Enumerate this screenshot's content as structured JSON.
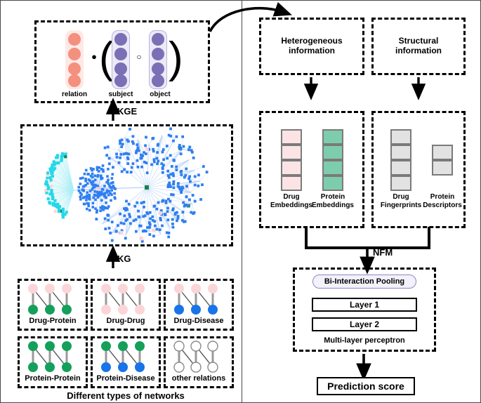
{
  "figure": {
    "panels": {
      "left_caption": "Different types of networks",
      "divider_color": "#4a4a4a"
    },
    "kge_block": {
      "operator_dot": "●",
      "operator_circle": "○",
      "paren_open": "(",
      "paren_close": ")",
      "vectors": [
        {
          "name": "relation",
          "label": "relation",
          "cells": 4,
          "dot_color": "#f4907e",
          "box_color": "#fde9e6"
        },
        {
          "name": "subject",
          "label": "subject",
          "cells": 4,
          "dot_color": "#7b6fb5",
          "box_color": "#eceaf6"
        },
        {
          "name": "object",
          "label": "object",
          "cells": 4,
          "dot_color": "#7b6fb5",
          "box_color": "#eceaf6"
        }
      ],
      "arrow_label": "KGE"
    },
    "kg_block": {
      "arrow_label": "KG",
      "graph": {
        "type": "network-graph",
        "main_cluster_color": "#2f7ef0",
        "secondary_cluster_color": "#25d8e8",
        "highlight_drug_color": "#fbd5d8",
        "highlight_protein_color": "#12844a",
        "edge_color": "#9ec4f5"
      }
    },
    "networks": [
      {
        "name": "drug-protein",
        "label": "Drug-Protein",
        "top_color": "#fbd5d8",
        "bottom_color": "#14a05a"
      },
      {
        "name": "drug-drug",
        "label": "Drug-Drug",
        "top_color": "#fbd5d8",
        "bottom_color": "#fbd5d8"
      },
      {
        "name": "drug-disease",
        "label": "Drug-Disease",
        "top_color": "#fbd5d8",
        "bottom_color": "#1874e8"
      },
      {
        "name": "protein-protein",
        "label": "Protein-Protein",
        "top_color": "#14a05a",
        "bottom_color": "#14a05a"
      },
      {
        "name": "protein-disease",
        "label": "Protein-Disease",
        "top_color": "#14a05a",
        "bottom_color": "#1874e8"
      },
      {
        "name": "other-relations",
        "label": "other relations",
        "top_color": "#ffffff",
        "bottom_color": "#ffffff"
      }
    ],
    "info_sources": [
      {
        "name": "heterogeneous",
        "label": "Heterogeneous\ninformation",
        "line1": "Heterogeneous",
        "line2": "information"
      },
      {
        "name": "structural",
        "label": "Structural\ninformation",
        "line1": "Structural",
        "line2": "information"
      }
    ],
    "features": {
      "heterogeneous": [
        {
          "name": "drug-embeddings",
          "line1": "Drug",
          "line2": "Embeddings",
          "cells": 4,
          "fill": "#fce4e6"
        },
        {
          "name": "protein-embeddings",
          "line1": "Protein",
          "line2": "Embeddings",
          "cells": 4,
          "fill": "#7eccae"
        }
      ],
      "structural": [
        {
          "name": "drug-fingerprints",
          "line1": "Drug",
          "line2": "Fingerprints",
          "cells": 4,
          "fill": "#e2e2e2"
        },
        {
          "name": "protein-descriptors",
          "line1": "Protein",
          "line2": "Descriptors",
          "cells": 2,
          "fill": "#e2e2e2"
        }
      ]
    },
    "nfm": {
      "arrow_label": "NFM",
      "pooling_label": "Bi-Interaction Pooling",
      "layers": [
        "Layer 1",
        "Layer 2"
      ],
      "mlp_caption": "Multi-layer perceptron"
    },
    "output": {
      "label": "Prediction score"
    }
  }
}
